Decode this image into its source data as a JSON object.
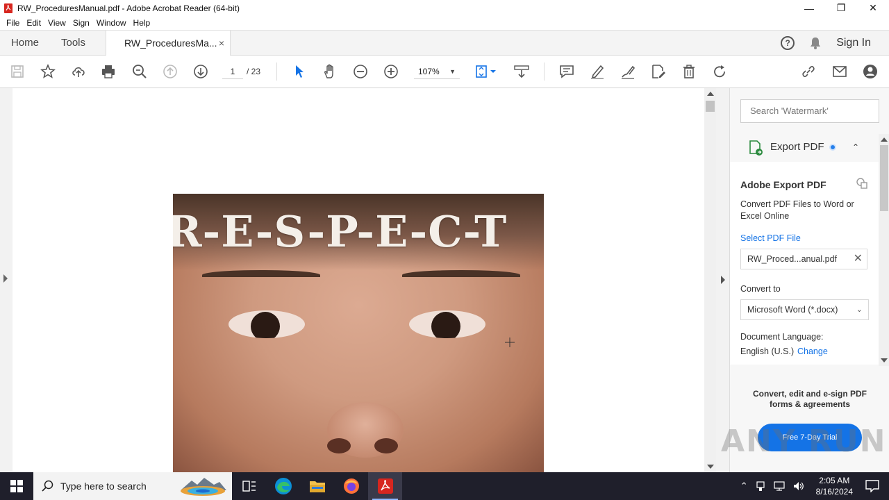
{
  "window": {
    "title": "RW_ProceduresManual.pdf - Adobe Acrobat Reader (64-bit)",
    "controls": {
      "minimize": "—",
      "restore": "❐",
      "close": "✕"
    }
  },
  "menu": [
    "File",
    "Edit",
    "View",
    "Sign",
    "Window",
    "Help"
  ],
  "tabs": {
    "home": "Home",
    "tools": "Tools",
    "doc": "RW_ProceduresMa...",
    "close": "×",
    "signin": "Sign In",
    "help": "?"
  },
  "toolbar": {
    "page_current": "1",
    "page_total": "/  23",
    "zoom": "107%",
    "zoom_caret": "▼",
    "icons": [
      "save-icon",
      "bookmark-star-icon",
      "upload-icon",
      "print-icon",
      "zoom-search-icon",
      "page-up-icon",
      "page-down-icon",
      "select-arrow-icon",
      "hand-icon",
      "zoom-out-icon",
      "zoom-in-icon",
      "fit-page-icon",
      "scroll-mode-icon",
      "comment-icon",
      "highlight-icon",
      "sign-icon",
      "edit-pdf-icon",
      "delete-icon",
      "rotate-icon",
      "share-link-icon",
      "email-icon",
      "add-person-icon"
    ]
  },
  "document": {
    "cover_text": "R-E-S-P-E-C-T"
  },
  "panel": {
    "search_placeholder": "Search 'Watermark'",
    "export_title": "Export PDF",
    "export_chevron": "⌃",
    "service_title": "Adobe Export PDF",
    "service_desc": "Convert PDF Files to Word or Excel Online",
    "select_file_label": "Select PDF File",
    "selected_file": "RW_Proced...anual.pdf",
    "file_clear": "✕",
    "convert_to_label": "Convert to",
    "convert_to_value": "Microsoft Word (*.docx)",
    "convert_caret": "⌄",
    "doc_language_label": "Document Language:",
    "doc_language_value": "English (U.S.)",
    "change_link": "Change",
    "promo_text": "Convert, edit and e-sign PDF forms & agreements",
    "trial_button": "Free 7-Day Trial"
  },
  "watermark": "ANY RUN",
  "taskbar": {
    "search_placeholder": "Type here to search",
    "apps": [
      "task-view-icon",
      "edge-icon",
      "file-explorer-icon",
      "firefox-icon",
      "acrobat-icon"
    ],
    "time": "2:05 AM",
    "date": "8/16/2024"
  },
  "colors": {
    "accent": "#1473e6",
    "taskbar": "#1f1f2b",
    "acrobat_red": "#d7261f"
  }
}
